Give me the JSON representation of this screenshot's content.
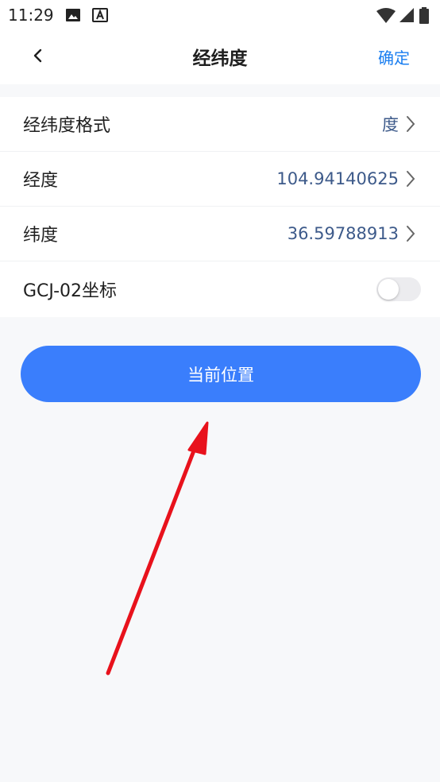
{
  "status_bar": {
    "time": "11:29",
    "icons": [
      "image-icon",
      "font-a-icon",
      "wifi-icon",
      "cellular-icon",
      "battery-icon"
    ]
  },
  "header": {
    "title": "经纬度",
    "confirm_label": "确定",
    "back_icon": "chevron-left-icon"
  },
  "rows": [
    {
      "label": "经纬度格式",
      "value": "度"
    },
    {
      "label": "经度",
      "value": "104.94140625"
    },
    {
      "label": "纬度",
      "value": "36.59788913"
    },
    {
      "label": "GCJ-02坐标",
      "toggle_on": false
    }
  ],
  "current_location_button": "当前位置",
  "colors": {
    "accent": "#3a7efc",
    "confirm": "#1a7ef0",
    "value_text": "#3d5a8a",
    "annotation_arrow": "#e8121c"
  }
}
